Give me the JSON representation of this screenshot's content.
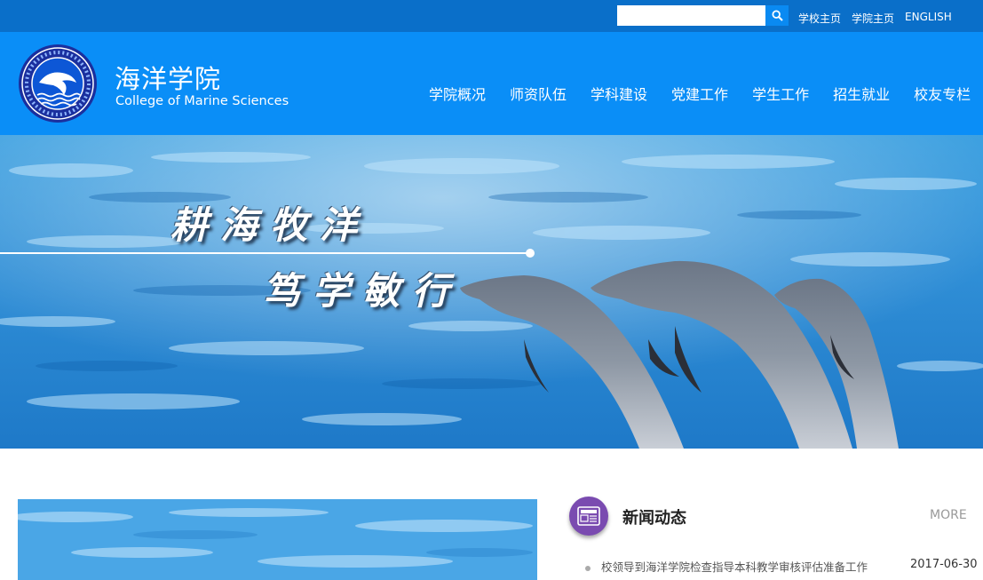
{
  "topbar": {
    "search": {
      "value": "",
      "placeholder": ""
    },
    "links": [
      "学校主页",
      "学院主页",
      "ENGLISH"
    ]
  },
  "header": {
    "title_cn": "海洋学院",
    "title_en": "College of Marine Sciences",
    "nav": [
      "学院概况",
      "师资队伍",
      "学科建设",
      "党建工作",
      "学生工作",
      "招生就业",
      "校友专栏"
    ]
  },
  "banner": {
    "slogan_line1": "耕海牧洋",
    "slogan_line2": "笃学敏行"
  },
  "news": {
    "title": "新闻动态",
    "more": "MORE",
    "items": [
      {
        "text": "校领导到海洋学院检查指导本科教学审核评估准备工作",
        "date": "2017-06-30"
      }
    ]
  },
  "colors": {
    "topbar": "#0a6fc9",
    "header": "#0a8ef7",
    "news_icon": "#7a4bb0"
  },
  "icons": [
    "search-icon",
    "college-emblem",
    "news-icon"
  ]
}
